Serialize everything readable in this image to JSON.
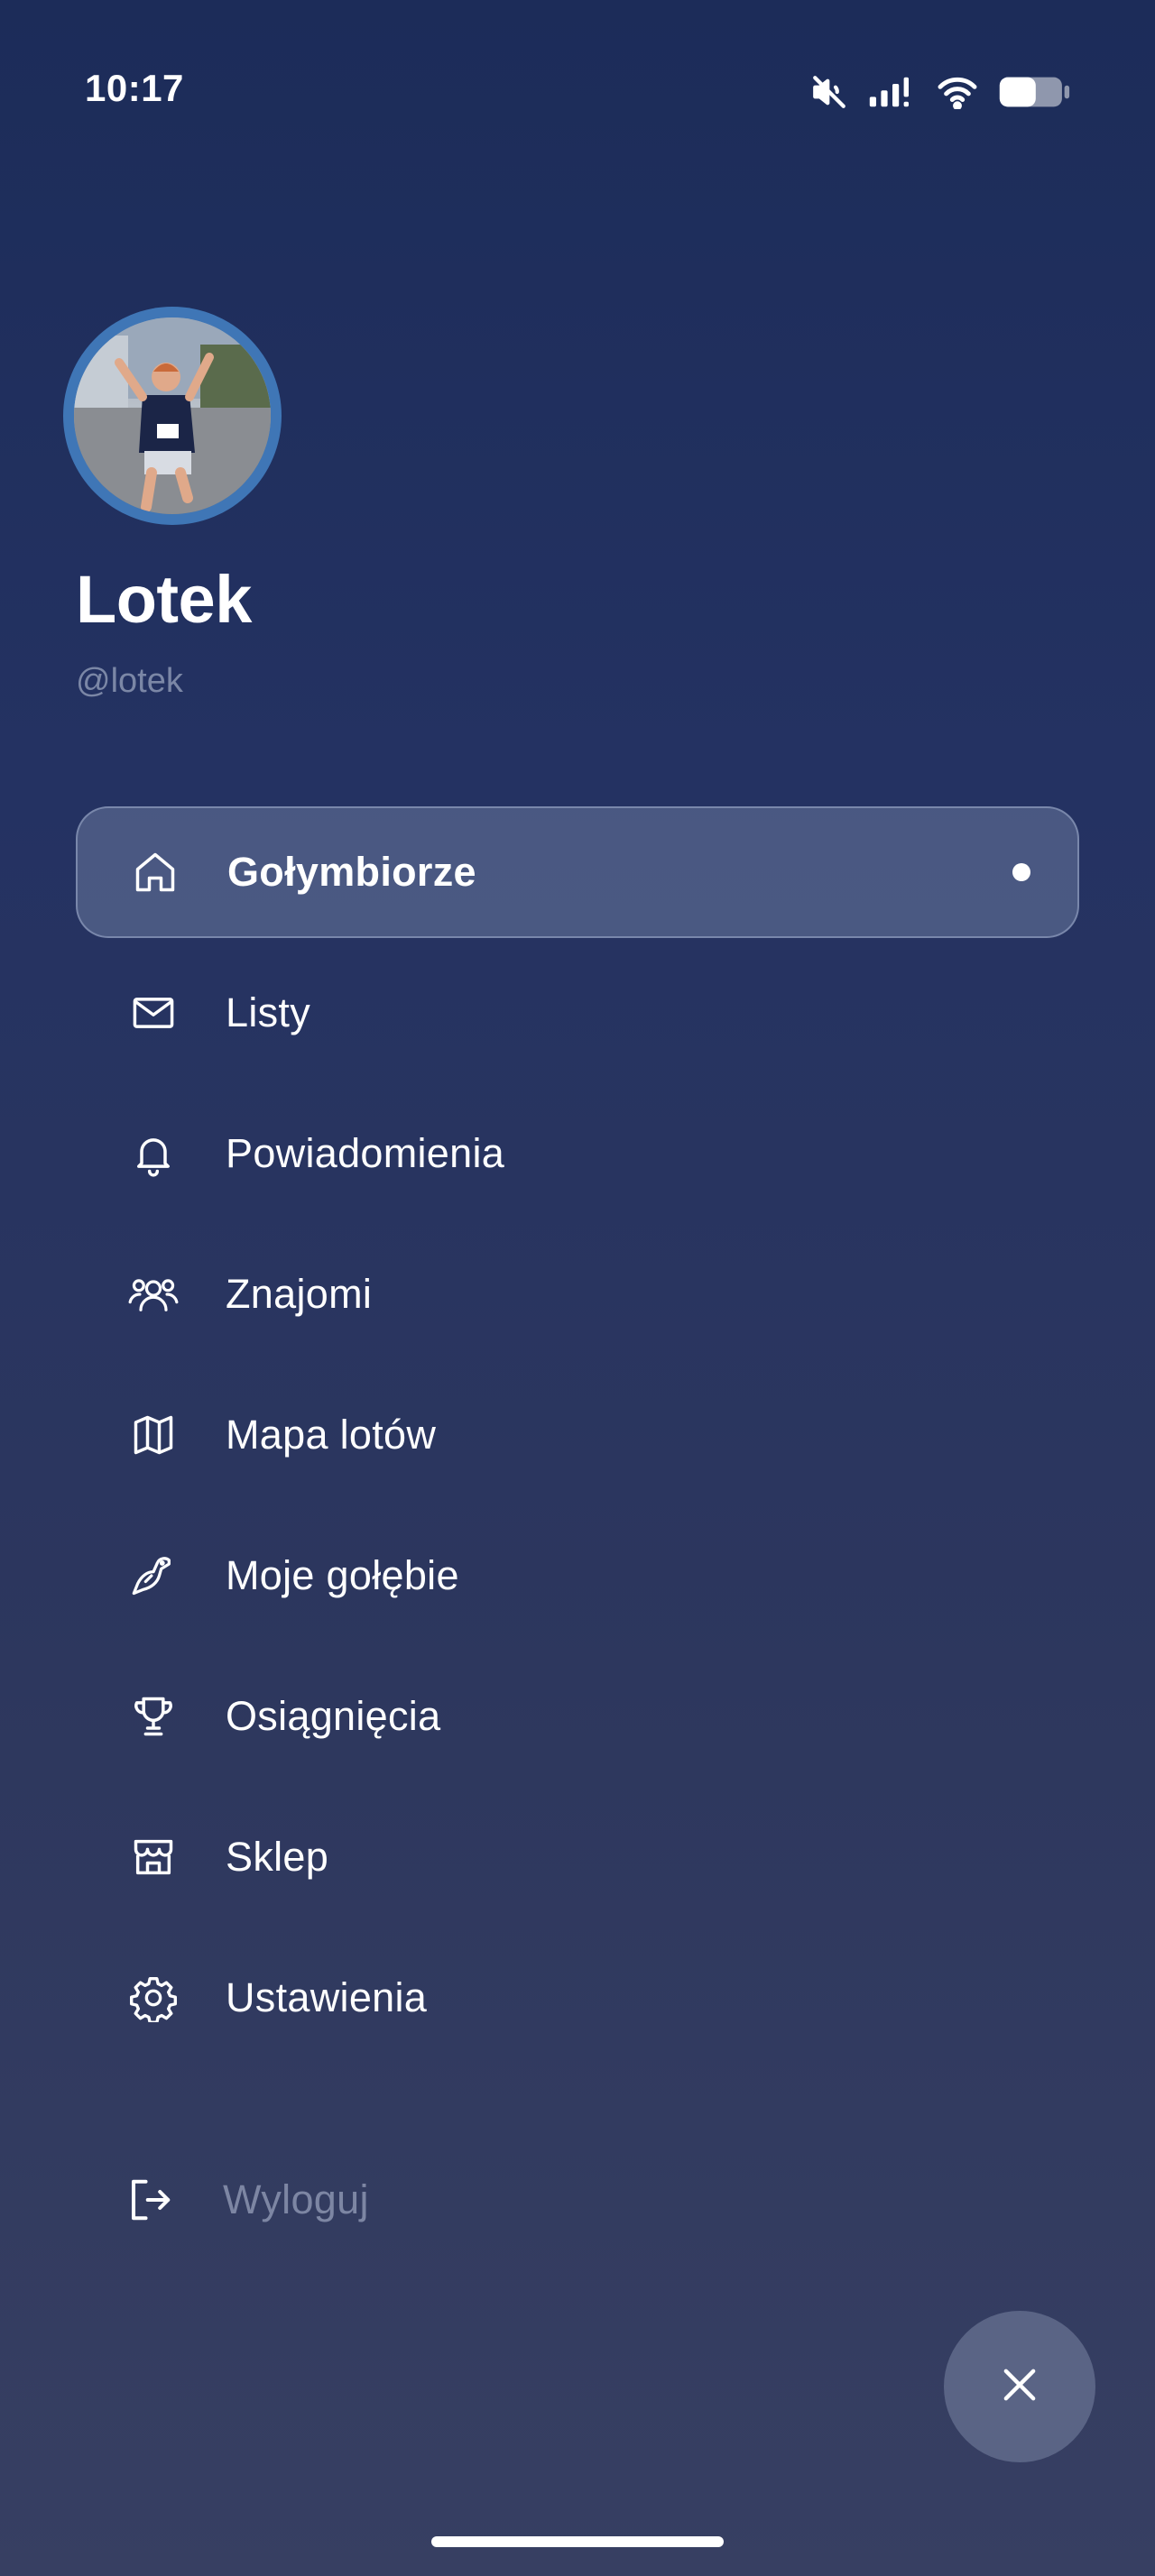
{
  "status_bar": {
    "time": "10:17",
    "icons": [
      "mute-icon",
      "signal-icon",
      "wifi-icon",
      "battery-icon"
    ]
  },
  "profile": {
    "name": "Lotek",
    "handle": "@lotek",
    "avatar": "avatar-photo"
  },
  "nav": {
    "items": [
      {
        "label": "Gołymbiorze",
        "icon": "home-icon",
        "active": true
      },
      {
        "label": "Listy",
        "icon": "mail-icon",
        "active": false
      },
      {
        "label": "Powiadomienia",
        "icon": "bell-icon",
        "active": false
      },
      {
        "label": "Znajomi",
        "icon": "users-icon",
        "active": false
      },
      {
        "label": "Mapa lotów",
        "icon": "map-icon",
        "active": false
      },
      {
        "label": "Moje gołębie",
        "icon": "bird-icon",
        "active": false
      },
      {
        "label": "Osiągnięcia",
        "icon": "trophy-icon",
        "active": false
      },
      {
        "label": "Sklep",
        "icon": "store-icon",
        "active": false
      },
      {
        "label": "Ustawienia",
        "icon": "gear-icon",
        "active": false
      }
    ]
  },
  "logout": {
    "label": "Wyloguj",
    "icon": "logout-icon"
  },
  "close_button": {
    "icon": "close-icon"
  },
  "colors": {
    "background_top": "#1c2c59",
    "background_bottom": "#373f62",
    "avatar_ring": "#3f76b6",
    "handle_text": "#7b87a6",
    "logout_text": "#7d86a3",
    "fab": "#5a6485"
  }
}
